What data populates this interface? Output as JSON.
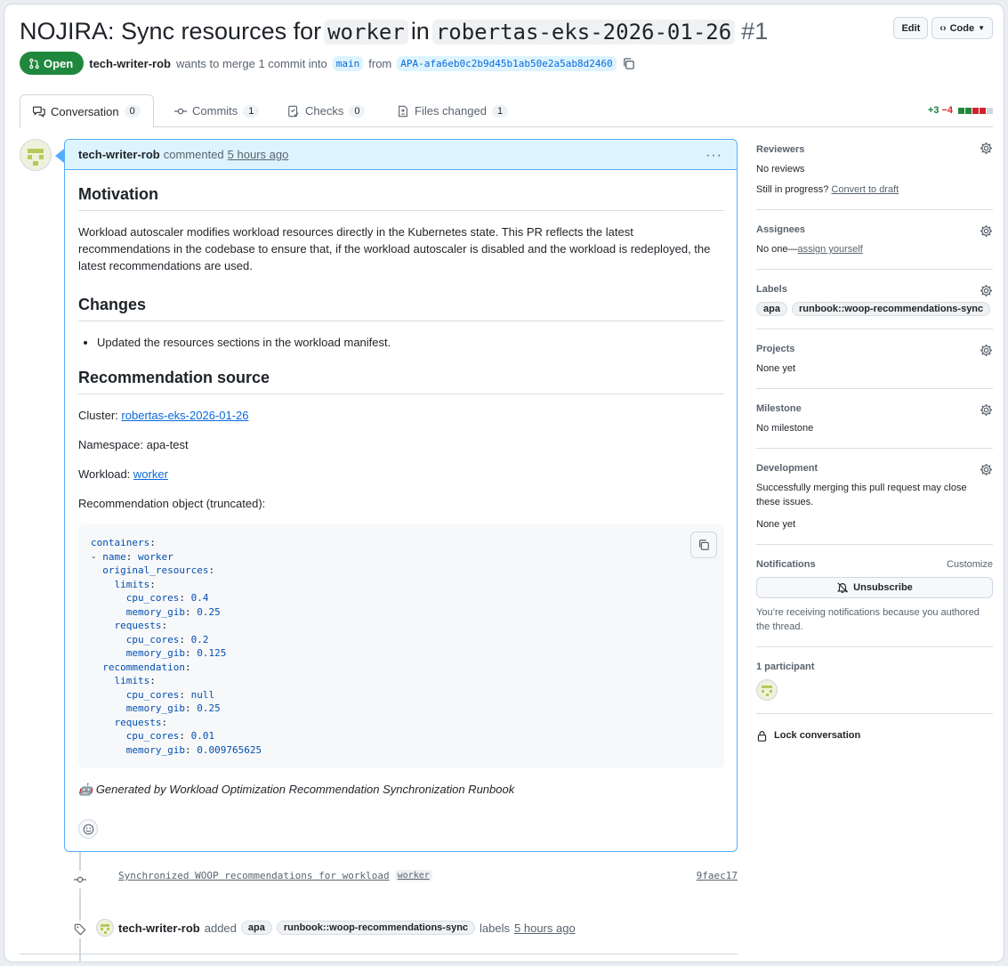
{
  "pr": {
    "title_prefix": "NOJIRA: Sync resources for",
    "title_code1": "worker",
    "title_mid": "in",
    "title_code2": "robertas-eks-2026-01-26",
    "number": "#1",
    "edit_label": "Edit",
    "code_label": "Code",
    "state": "Open",
    "author": "tech-writer-rob",
    "merge_text": "wants to merge 1 commit into",
    "base_branch": "main",
    "from_text": "from",
    "head_branch": "APA-afa6eb0c2b9d45b1ab50e2a5ab8d2460"
  },
  "tabs": [
    {
      "label": "Conversation",
      "count": "0"
    },
    {
      "label": "Commits",
      "count": "1"
    },
    {
      "label": "Checks",
      "count": "0"
    },
    {
      "label": "Files changed",
      "count": "1"
    }
  ],
  "diffstat": {
    "additions": "+3",
    "deletions": "−4"
  },
  "comment": {
    "author": "tech-writer-rob",
    "action": "commented",
    "time": "5 hours ago",
    "motivation_heading": "Motivation",
    "motivation_text": "Workload autoscaler modifies workload resources directly in the Kubernetes state. This PR reflects the latest recommendations in the codebase to ensure that, if the workload autoscaler is disabled and the workload is redeployed, the latest recommendations are used.",
    "changes_heading": "Changes",
    "changes_item": "Updated the resources sections in the workload manifest.",
    "source_heading": "Recommendation source",
    "cluster_label": "Cluster:",
    "cluster_value": "robertas-eks-2026-01-26",
    "namespace_line": "Namespace: apa-test",
    "workload_label": "Workload:",
    "workload_value": "worker",
    "rec_intro": "Recommendation object (truncated):",
    "code_lines": [
      {
        "indent": 0,
        "key": "containers",
        "sep": ":",
        "val": ""
      },
      {
        "indent": 0,
        "key": "name",
        "sep": ": ",
        "val": "worker",
        "dash": true
      },
      {
        "indent": 2,
        "key": "original_resources",
        "sep": ":",
        "val": ""
      },
      {
        "indent": 4,
        "key": "limits",
        "sep": ":",
        "val": ""
      },
      {
        "indent": 6,
        "key": "cpu_cores",
        "sep": ": ",
        "val": "0.4"
      },
      {
        "indent": 6,
        "key": "memory_gib",
        "sep": ": ",
        "val": "0.25"
      },
      {
        "indent": 4,
        "key": "requests",
        "sep": ":",
        "val": ""
      },
      {
        "indent": 6,
        "key": "cpu_cores",
        "sep": ": ",
        "val": "0.2"
      },
      {
        "indent": 6,
        "key": "memory_gib",
        "sep": ": ",
        "val": "0.125"
      },
      {
        "indent": 2,
        "key": "recommendation",
        "sep": ":",
        "val": ""
      },
      {
        "indent": 4,
        "key": "limits",
        "sep": ":",
        "val": ""
      },
      {
        "indent": 6,
        "key": "cpu_cores",
        "sep": ": ",
        "val": "null"
      },
      {
        "indent": 6,
        "key": "memory_gib",
        "sep": ": ",
        "val": "0.25"
      },
      {
        "indent": 4,
        "key": "requests",
        "sep": ":",
        "val": ""
      },
      {
        "indent": 6,
        "key": "cpu_cores",
        "sep": ": ",
        "val": "0.01"
      },
      {
        "indent": 6,
        "key": "memory_gib",
        "sep": ": ",
        "val": "0.009765625"
      }
    ],
    "footer_emoji": "🤖",
    "footer_text": "Generated by Workload Optimization Recommendation Synchronization Runbook"
  },
  "timeline": {
    "commit_message": "Synchronized WOOP recommendations for workload",
    "commit_chip": "worker",
    "commit_sha": "9faec17",
    "label_event_author": "tech-writer-rob",
    "label_event_action": "added",
    "label_event_labels": [
      "apa",
      "runbook::woop-recommendations-sync"
    ],
    "label_event_suffix": "labels",
    "label_event_time": "5 hours ago"
  },
  "sidebar": {
    "reviewers_heading": "Reviewers",
    "reviewers_value": "No reviews",
    "reviewers_progress": "Still in progress?",
    "reviewers_draft_link": "Convert to draft",
    "assignees_heading": "Assignees",
    "assignees_value": "No one—",
    "assignees_link": "assign yourself",
    "labels_heading": "Labels",
    "labels": [
      "apa",
      "runbook::woop-recommendations-sync"
    ],
    "projects_heading": "Projects",
    "projects_value": "None yet",
    "milestone_heading": "Milestone",
    "milestone_value": "No milestone",
    "development_heading": "Development",
    "development_text": "Successfully merging this pull request may close these issues.",
    "development_value": "None yet",
    "notifications_heading": "Notifications",
    "notifications_customize": "Customize",
    "unsubscribe_label": "Unsubscribe",
    "notifications_reason": "You’re receiving notifications because you authored the thread.",
    "participants_heading": "1 participant",
    "lock_label": "Lock conversation"
  },
  "colors": {
    "open_green": "#1f883d",
    "link_blue": "#0969da",
    "comment_border": "#54aeff",
    "comment_header_bg": "#ddf4ff"
  }
}
